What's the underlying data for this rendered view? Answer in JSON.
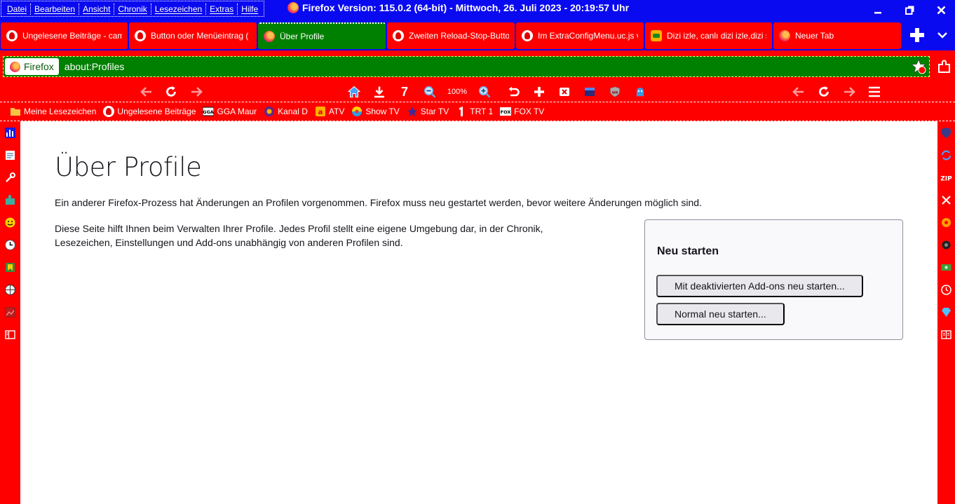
{
  "menubar": {
    "items": [
      "Datei",
      "Bearbeiten",
      "Ansicht",
      "Chronik",
      "Lesezeichen",
      "Extras",
      "Hilfe"
    ]
  },
  "window": {
    "title": "Firefox Version: 115.0.2 (64-bit) -  Mittwoch, 26. Juli 2023 - 20:19:57 Uhr"
  },
  "tabs": [
    {
      "label": "Ungelesene Beiträge - cam",
      "icon": "red-flame-icon"
    },
    {
      "label": "Button oder Menüeintrag (",
      "icon": "red-flame-icon"
    },
    {
      "label": "Über Profile",
      "icon": "firefox-icon",
      "selected": true
    },
    {
      "label": "Zweiten Reload-Stop-Butto",
      "icon": "red-flame-icon"
    },
    {
      "label": "Im ExtraConfigMenu.uc.js v",
      "icon": "red-flame-icon"
    },
    {
      "label": "Dizi izle, canlı dizi izle,dizi s",
      "icon": "dizi-icon"
    },
    {
      "label": "Neuer Tab",
      "icon": "firefox-icon"
    }
  ],
  "urlbar": {
    "identity": "Firefox",
    "url": "about:Profiles"
  },
  "toolbar": {
    "counter": "7",
    "zoom": "100%"
  },
  "bookmarks": [
    {
      "label": "Meine Lesezeichen",
      "icon": "folder-icon"
    },
    {
      "label": "Ungelesene Beiträge",
      "icon": "red-flame-icon"
    },
    {
      "label": "GGA Maur",
      "icon": "gga-icon"
    },
    {
      "label": "Kanal D",
      "icon": "kanal-d-icon"
    },
    {
      "label": "ATV",
      "icon": "atv-icon"
    },
    {
      "label": "Show TV",
      "icon": "show-tv-icon"
    },
    {
      "label": "Star TV",
      "icon": "star-tv-icon"
    },
    {
      "label": "TRT 1",
      "icon": "trt1-icon"
    },
    {
      "label": "FOX TV",
      "icon": "fox-tv-icon"
    }
  ],
  "page": {
    "title": "Über Profile",
    "warning": "Ein anderer Firefox-Prozess hat Änderungen an Profilen vorgenommen. Firefox muss neu gestartet werden, bevor weitere Änderungen möglich sind.",
    "description": "Diese Seite hilft Ihnen beim Verwalten Ihrer Profile. Jedes Profil stellt eine eigene Umgebung dar, in der Chronik, Lesezeichen, Einstellungen und Add-ons unabhängig von anderen Profilen sind.",
    "restart": {
      "heading": "Neu starten",
      "restart_without_addons": "Mit deaktivierten Add-ons neu starten...",
      "restart_normal": "Normal neu starten..."
    }
  },
  "colors": {
    "titlebar": "#0a0af0",
    "toolbar": "#ff0000",
    "selected_tab": "#008000",
    "urlbar": "#008000"
  }
}
